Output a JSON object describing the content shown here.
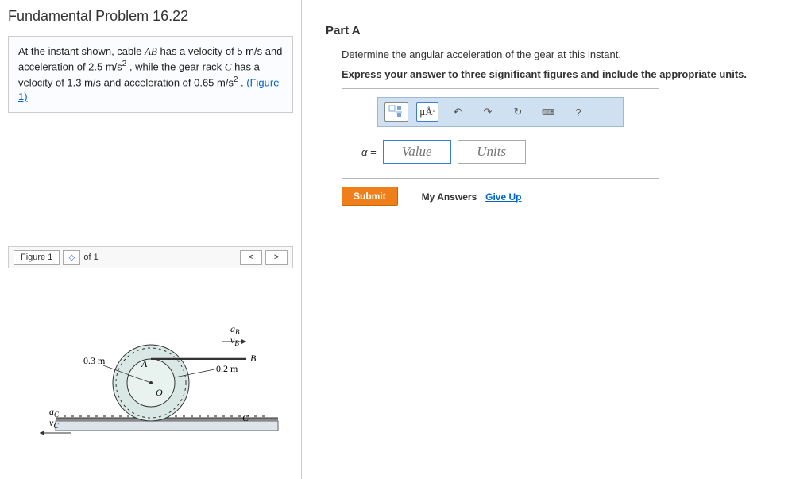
{
  "problem": {
    "title": "Fundamental Problem 16.22",
    "text_pre": "At the instant shown, cable ",
    "cable_label": "AB",
    "text_mid1": " has a velocity of 5 m/s and acceleration of 2.5 m/s",
    "sup1": "2",
    "text_mid2": " , while the gear rack ",
    "rack_label": "C",
    "text_mid3": " has a velocity of 1.3 m/s and acceleration of 0.65 m/s",
    "sup2": "2",
    "text_end": " . ",
    "figure_link": "(Figure 1)"
  },
  "figure": {
    "tab_label": "Figure 1",
    "pager": "of 1",
    "prev": "<",
    "next": ">",
    "r_inner": "0.2 m",
    "r_outer": "0.3 m",
    "labels": {
      "A": "A",
      "B": "B",
      "C": "C",
      "O": "O",
      "aB": "a",
      "aBsub": "B",
      "vB": "v",
      "vBsub": "B",
      "aC": "a",
      "aCsub": "C",
      "vC": "v",
      "vCsub": "C"
    }
  },
  "partA": {
    "title": "Part A",
    "prompt": "Determine the angular acceleration of the gear at this instant.",
    "instruction": "Express your answer to three significant figures and include the appropriate units.",
    "toolbar": {
      "micro_units": "μÅ",
      "undo": "↶",
      "redo": "↷",
      "reset": "↻",
      "keyboard": "⌨",
      "help": "?"
    },
    "alpha_label": "α =",
    "value_placeholder": "Value",
    "units_placeholder": "Units",
    "submit": "Submit",
    "my_answers": "My Answers",
    "give_up": "Give Up"
  }
}
